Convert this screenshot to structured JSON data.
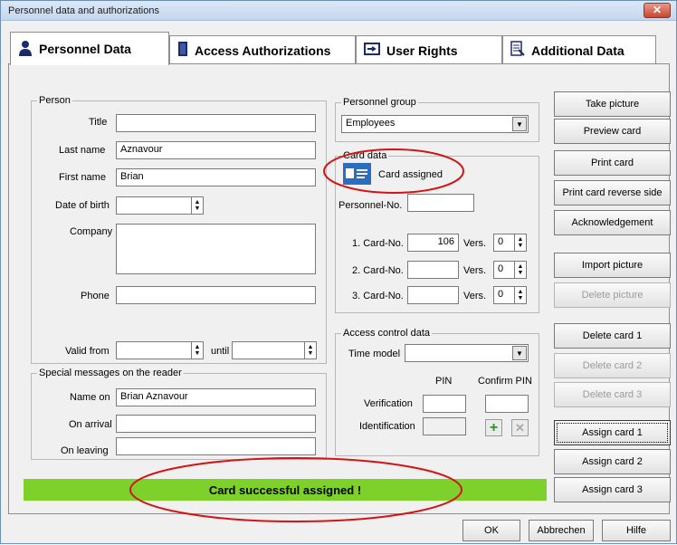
{
  "window": {
    "title": "Personnel data and authorizations"
  },
  "tabs": [
    {
      "label": "Personnel Data",
      "icon": "person-icon"
    },
    {
      "label": "Access Authorizations",
      "icon": "door-icon"
    },
    {
      "label": "User Rights",
      "icon": "key-card-icon"
    },
    {
      "label": "Additional Data",
      "icon": "document-icon"
    }
  ],
  "person": {
    "group_label": "Person",
    "title_label": "Title",
    "title_value": "",
    "last_name_label": "Last name",
    "last_name_value": "Aznavour",
    "first_name_label": "First name",
    "first_name_value": "Brian",
    "dob_label": "Date of birth",
    "dob_value": "",
    "company_label": "Company",
    "company_value": "",
    "phone_label": "Phone",
    "phone_value": "",
    "valid_from_label": "Valid from",
    "valid_from_value": "",
    "until_label": "until",
    "until_value": ""
  },
  "messages": {
    "group_label": "Special messages on the reader",
    "name_on_label": "Name on",
    "name_on_value": "Brian Aznavour",
    "on_arrival_label": "On arrival",
    "on_arrival_value": "",
    "on_leaving_label": "On leaving",
    "on_leaving_value": ""
  },
  "personnel_group": {
    "group_label": "Personnel group",
    "selected": "Employees"
  },
  "card_data": {
    "group_label": "Card data",
    "status": "Card assigned",
    "personnel_no_label": "Personnel-No.",
    "personnel_no_value": "",
    "vers_label": "Vers.",
    "cards": [
      {
        "label": "1. Card-No.",
        "number": "106",
        "version": "0"
      },
      {
        "label": "2. Card-No.",
        "number": "",
        "version": "0"
      },
      {
        "label": "3. Card-No.",
        "number": "",
        "version": "0"
      }
    ]
  },
  "access_control": {
    "group_label": "Access control data",
    "time_model_label": "Time model",
    "time_model_value": "",
    "pin_label": "PIN",
    "confirm_pin_label": "Confirm PIN",
    "verification_label": "Verification",
    "identification_label": "Identification"
  },
  "side_buttons": {
    "take_picture": "Take picture",
    "preview_card": "Preview card",
    "print_card": "Print card",
    "print_card_reverse": "Print card reverse side",
    "acknowledgement": "Acknowledgement",
    "import_picture": "Import picture",
    "delete_picture": "Delete picture",
    "delete_card_1": "Delete card 1",
    "delete_card_2": "Delete card 2",
    "delete_card_3": "Delete card 3",
    "assign_card_1": "Assign card 1",
    "assign_card_2": "Assign card 2",
    "assign_card_3": "Assign card 3"
  },
  "status_message": "Card successful assigned !",
  "dialog_buttons": {
    "ok": "OK",
    "cancel": "Abbrechen",
    "help": "Hilfe"
  },
  "colors": {
    "status_green": "#7ed12a",
    "annotation_red": "#d21414"
  }
}
